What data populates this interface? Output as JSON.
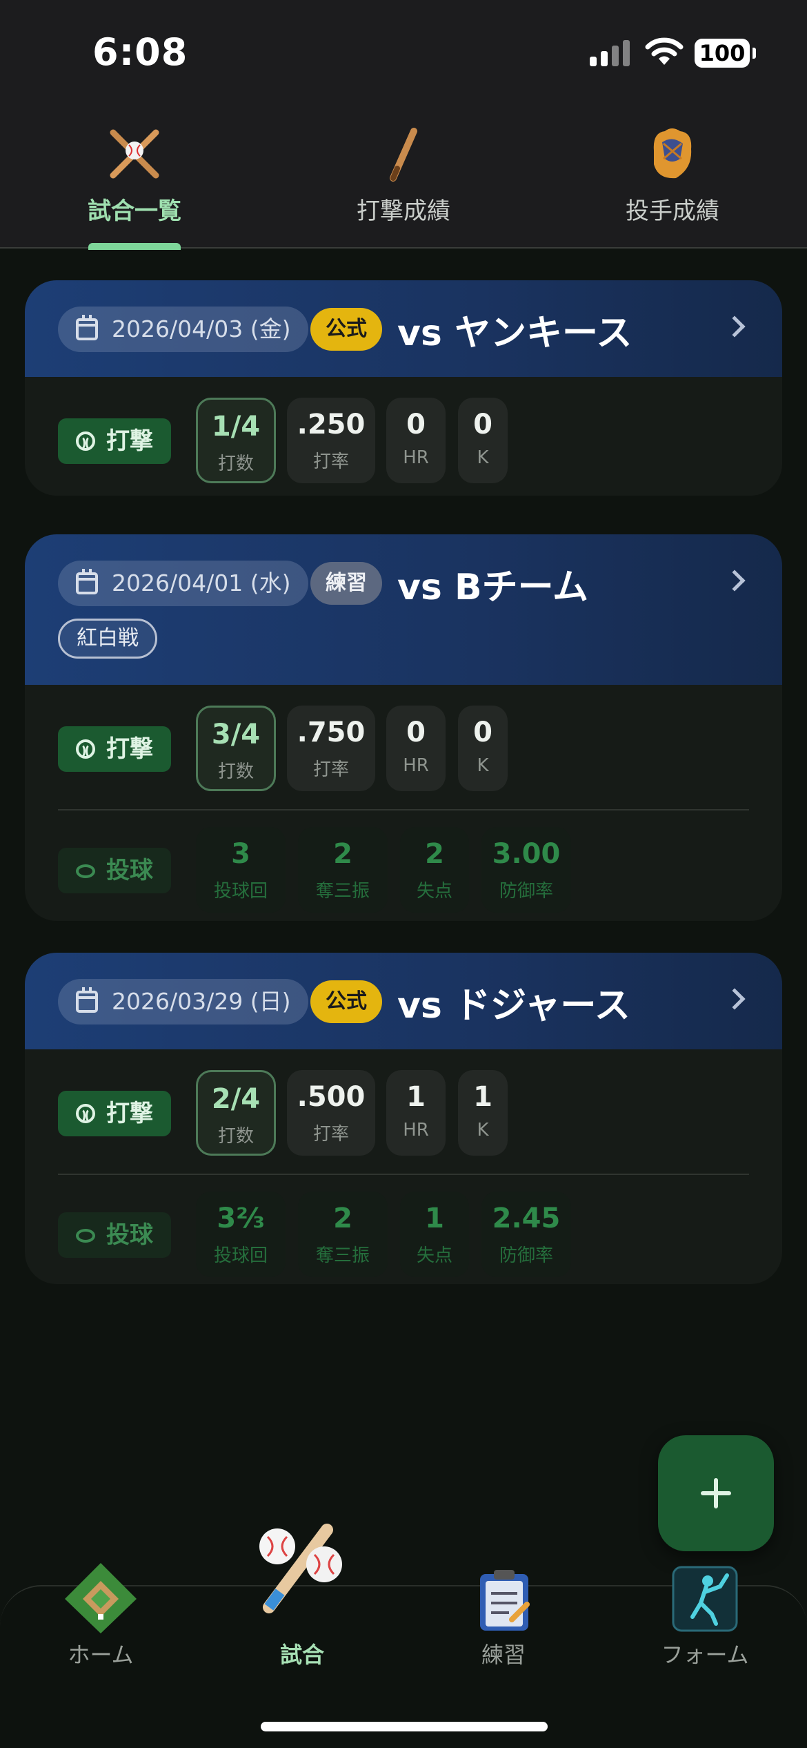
{
  "status_bar": {
    "time": "6:08",
    "battery": "100",
    "icons": [
      "signal-icon",
      "wifi-icon",
      "battery-icon"
    ]
  },
  "top_tabs": [
    {
      "label": "試合一覧",
      "icon": "crossed-bats-icon",
      "active": true
    },
    {
      "label": "打撃成績",
      "icon": "bat-icon",
      "active": false
    },
    {
      "label": "投手成績",
      "icon": "glove-icon",
      "active": false
    }
  ],
  "games": [
    {
      "date": "2026/04/03 (金)",
      "type": "公式",
      "opponent": "vs ヤンキース",
      "batting": {
        "label": "打撃",
        "stats": [
          {
            "value": "1/4",
            "label": "打数"
          },
          {
            "value": ".250",
            "label": "打率"
          },
          {
            "value": "0",
            "label": "HR"
          },
          {
            "value": "0",
            "label": "K"
          }
        ]
      }
    },
    {
      "date": "2026/04/01 (水)",
      "type": "練習",
      "opponent": "vs Bチーム",
      "tag": "紅白戦",
      "batting": {
        "label": "打撃",
        "stats": [
          {
            "value": "3/4",
            "label": "打数"
          },
          {
            "value": ".750",
            "label": "打率"
          },
          {
            "value": "0",
            "label": "HR"
          },
          {
            "value": "0",
            "label": "K"
          }
        ]
      },
      "pitching": {
        "label": "投球",
        "stats": [
          {
            "value": "3",
            "label": "投球回"
          },
          {
            "value": "2",
            "label": "奪三振"
          },
          {
            "value": "2",
            "label": "失点"
          },
          {
            "value": "3.00",
            "label": "防御率"
          }
        ]
      }
    },
    {
      "date": "2026/03/29 (日)",
      "type": "公式",
      "opponent": "vs ドジャース",
      "batting": {
        "label": "打撃",
        "stats": [
          {
            "value": "2/4",
            "label": "打数"
          },
          {
            "value": ".500",
            "label": "打率"
          },
          {
            "value": "1",
            "label": "HR"
          },
          {
            "value": "1",
            "label": "K"
          }
        ]
      },
      "pitching": {
        "label": "投球",
        "stats": [
          {
            "value": "3⅔",
            "label": "投球回"
          },
          {
            "value": "2",
            "label": "奪三振"
          },
          {
            "value": "1",
            "label": "失点"
          },
          {
            "value": "2.45",
            "label": "防御率"
          }
        ]
      }
    }
  ],
  "fab": {
    "icon": "plus-icon"
  },
  "bottom_nav": [
    {
      "label": "ホーム",
      "icon": "baseball-field-icon",
      "active": false
    },
    {
      "label": "試合",
      "icon": "bat-and-balls-icon",
      "active": true
    },
    {
      "label": "練習",
      "icon": "clipboard-icon",
      "active": false
    },
    {
      "label": "フォーム",
      "icon": "batter-form-icon",
      "active": false
    }
  ],
  "colors": {
    "background": "#0e130f",
    "card_header": "#1d3e75",
    "official_badge": "#e4b50f",
    "practice_badge": "#5c6880",
    "accent_green": "#1b5a30",
    "active_tab": "#9fe0b0"
  }
}
